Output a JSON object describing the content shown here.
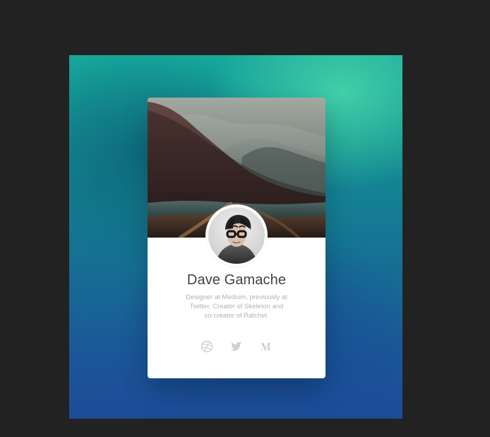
{
  "profile": {
    "name": "Dave Gamache",
    "bio": "Designer at Medium, previously at\nTwitter. Creator of Skeleton and\nco-creator of Ratchet."
  },
  "socials": [
    {
      "label": "Dribbble",
      "icon": "dribbble-icon"
    },
    {
      "label": "Twitter",
      "icon": "twitter-icon"
    },
    {
      "label": "Medium",
      "icon": "medium-icon"
    }
  ],
  "colors": {
    "page_background": "#222222",
    "backdrop_teal": "#16a79b",
    "backdrop_blue": "#1d4c98",
    "card_background": "#ffffff",
    "name_text": "#434343",
    "bio_text": "#b2b2b2",
    "social_icon": "#d0d0d0"
  }
}
